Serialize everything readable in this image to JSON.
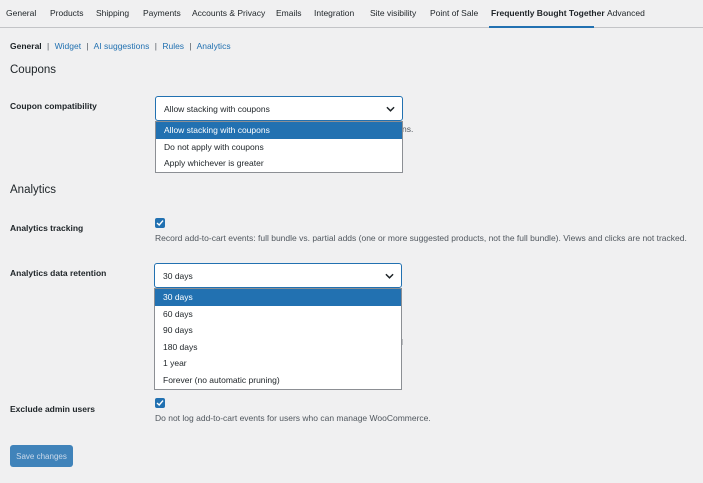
{
  "tabs": [
    {
      "label": "General"
    },
    {
      "label": "Products"
    },
    {
      "label": "Shipping"
    },
    {
      "label": "Payments"
    },
    {
      "label": "Accounts & Privacy"
    },
    {
      "label": "Emails"
    },
    {
      "label": "Integration"
    },
    {
      "label": "Site visibility"
    },
    {
      "label": "Point of Sale"
    },
    {
      "label": "Frequently Bought Together",
      "active": true
    },
    {
      "label": "Advanced"
    }
  ],
  "subnav": {
    "items": [
      "General",
      "Widget",
      "AI suggestions",
      "Rules",
      "Analytics"
    ],
    "separator": "|"
  },
  "coupons": {
    "heading": "Coupons",
    "label": "Coupon compatibility",
    "selected": "Allow stacking with coupons",
    "options": [
      "Allow stacking with coupons",
      "Do not apply with coupons",
      "Apply whichever is greater"
    ],
    "desc_fragment": "ns."
  },
  "analytics": {
    "heading": "Analytics",
    "tracking_label": "Analytics tracking",
    "tracking_checked": true,
    "tracking_desc": "Record add-to-cart events: full bundle vs. partial adds (one or more suggested products, not the full bundle). Views and clicks are not tracked.",
    "retention_label": "Analytics data retention",
    "retention_selected": "30 days",
    "retention_options": [
      "30 days",
      "60 days",
      "90 days",
      "180 days",
      "1 year",
      "Forever (no automatic pruning)"
    ],
    "retention_desc_fragment": "l",
    "exclude_label": "Exclude admin users",
    "exclude_checked": true,
    "exclude_desc": "Do not log add-to-cart events for users who can manage WooCommerce."
  },
  "save_button": "Save changes",
  "colors": {
    "accent": "#2271b1",
    "background": "#f0f0f1",
    "text": "#1d2327",
    "muted": "#50575e"
  }
}
